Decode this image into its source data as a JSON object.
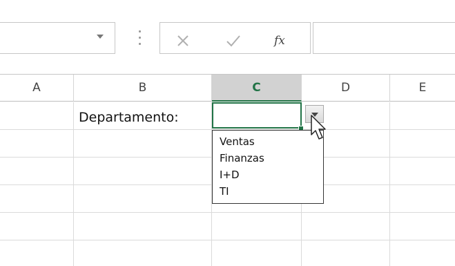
{
  "formula_bar": {
    "fx_label": "fx",
    "cancel_icon": "close-icon",
    "confirm_icon": "check-icon",
    "name_box_icon": "chevron-down-icon"
  },
  "columns": [
    "A",
    "B",
    "C",
    "D",
    "E"
  ],
  "active_column": "C",
  "cell_b2": "Departamento:",
  "dropdown": {
    "options": [
      "Ventas",
      "Finanzas",
      "I+D",
      "TI"
    ]
  },
  "colors": {
    "accent": "#217346",
    "grid": "#dadada",
    "header_active_bg": "#d2d2d2"
  }
}
